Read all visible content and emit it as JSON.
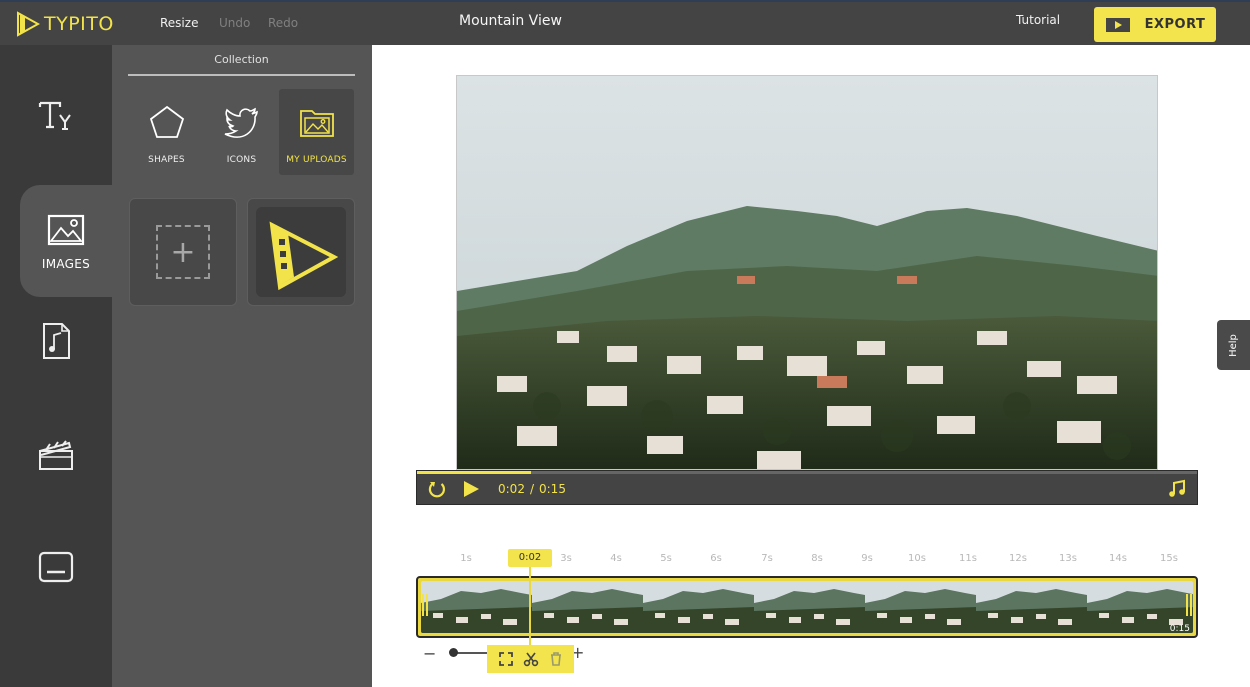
{
  "app": {
    "brand": "TYPITO",
    "project_title": "Mountain View"
  },
  "header": {
    "resize_label": "Resize",
    "undo_label": "Undo",
    "redo_label": "Redo",
    "tutorial_label": "Tutorial",
    "export_label": "EXPORT"
  },
  "sidebar": {
    "items": [
      {
        "id": "text",
        "icon": "text-icon",
        "label": ""
      },
      {
        "id": "images",
        "icon": "image-icon",
        "label": "IMAGES",
        "active": true
      },
      {
        "id": "audio",
        "icon": "music-file-icon",
        "label": ""
      },
      {
        "id": "video",
        "icon": "clapperboard-icon",
        "label": ""
      },
      {
        "id": "captions",
        "icon": "caption-icon",
        "label": ""
      }
    ]
  },
  "panel": {
    "heading": "Collection",
    "categories": [
      {
        "label": "SHAPES",
        "icon": "pentagon-icon"
      },
      {
        "label": "ICONS",
        "icon": "twitter-bird-icon"
      },
      {
        "label": "MY UPLOADS",
        "icon": "folder-image-icon",
        "active": true
      }
    ],
    "uploads": [
      {
        "type": "add",
        "icon": "plus-icon"
      },
      {
        "type": "image",
        "icon": "typito-logo-icon"
      }
    ]
  },
  "player": {
    "current_time": "0:02",
    "separator": "/",
    "duration": "0:15",
    "progress": 0.146
  },
  "timeline": {
    "ticks": [
      "1s",
      "3s",
      "4s",
      "5s",
      "6s",
      "7s",
      "8s",
      "9s",
      "10s",
      "11s",
      "12s",
      "13s",
      "14s",
      "15s"
    ],
    "playhead_label": "0:02",
    "clip_duration": "0:15",
    "zoom_minus": "−",
    "zoom_plus": "+"
  },
  "help_label": "Help",
  "colors": {
    "accent": "#f3e34c",
    "topbar": "#444444",
    "rail": "#3a3a3a",
    "panel": "#555555"
  }
}
